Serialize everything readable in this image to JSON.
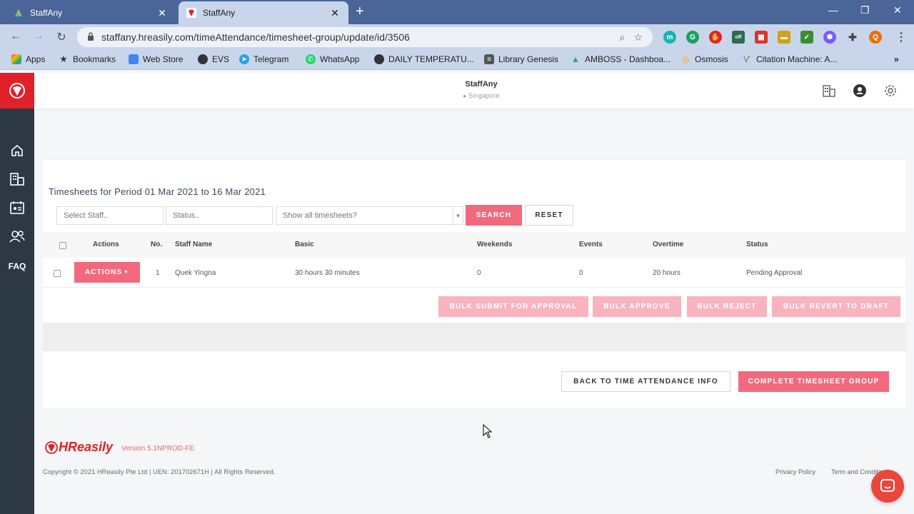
{
  "browser": {
    "tabs": [
      {
        "title": "StaffAny",
        "active": false
      },
      {
        "title": "StaffAny",
        "active": true
      }
    ],
    "url": "staffany.hreasily.com/timeAttendance/timesheet-group/update/id/3506",
    "bookmarks": [
      "Apps",
      "Bookmarks",
      "Web Store",
      "EVS",
      "Telegram",
      "WhatsApp",
      "DAILY TEMPERATU...",
      "Library Genesis",
      "AMBOSS - Dashboa...",
      "Osmosis",
      "Citation Machine: A..."
    ],
    "more_bookmarks": "»",
    "profile_initial": "Q",
    "ext_badge": "off"
  },
  "sidebar": {
    "faq_label": "FAQ"
  },
  "header": {
    "company": "StaffAny",
    "location": "Singapore"
  },
  "page": {
    "title": "Timesheets for Period 01 Mar 2021 to 16 Mar 2021",
    "filters": {
      "staff_placeholder": "Select Staff..",
      "status_placeholder": "Status..",
      "timesheets_placeholder": "Show all timesheets?"
    },
    "search_label": "SEARCH",
    "reset_label": "RESET",
    "columns": [
      "Actions",
      "No.",
      "Staff Name",
      "Basic",
      "Weekends",
      "Events",
      "Overtime",
      "Status"
    ],
    "rows": [
      {
        "actions_label": "ACTIONS",
        "no": "1",
        "staff_name": "Quek Yingna",
        "basic": "30 hours 30 minutes",
        "weekends": "0",
        "events": "0",
        "overtime": "20 hours",
        "status": "Pending Approval"
      }
    ],
    "bulk_buttons": {
      "submit": "BULK SUBMIT FOR APPROVAL",
      "approve": "BULK APPROVE",
      "reject": "BULK REJECT",
      "revert": "BULK REVERT TO DRAFT"
    },
    "back_label": "BACK TO TIME ATTENDANCE INFO",
    "complete_label": "COMPLETE TIMESHEET GROUP"
  },
  "footer": {
    "brand": "HReasily",
    "version": "Version 5.1NPROD-FE",
    "copyright": "Copyright © 2021 HReasily Pte Ltd | UEN: 201702671H | All Rights Reserved.",
    "privacy": "Privacy Policy",
    "terms": "Term and Conditions"
  },
  "colors": {
    "accent": "#f2697e",
    "brand_red": "#e2202a",
    "sidebar": "#2d3845",
    "chrome": "#4a6597"
  }
}
